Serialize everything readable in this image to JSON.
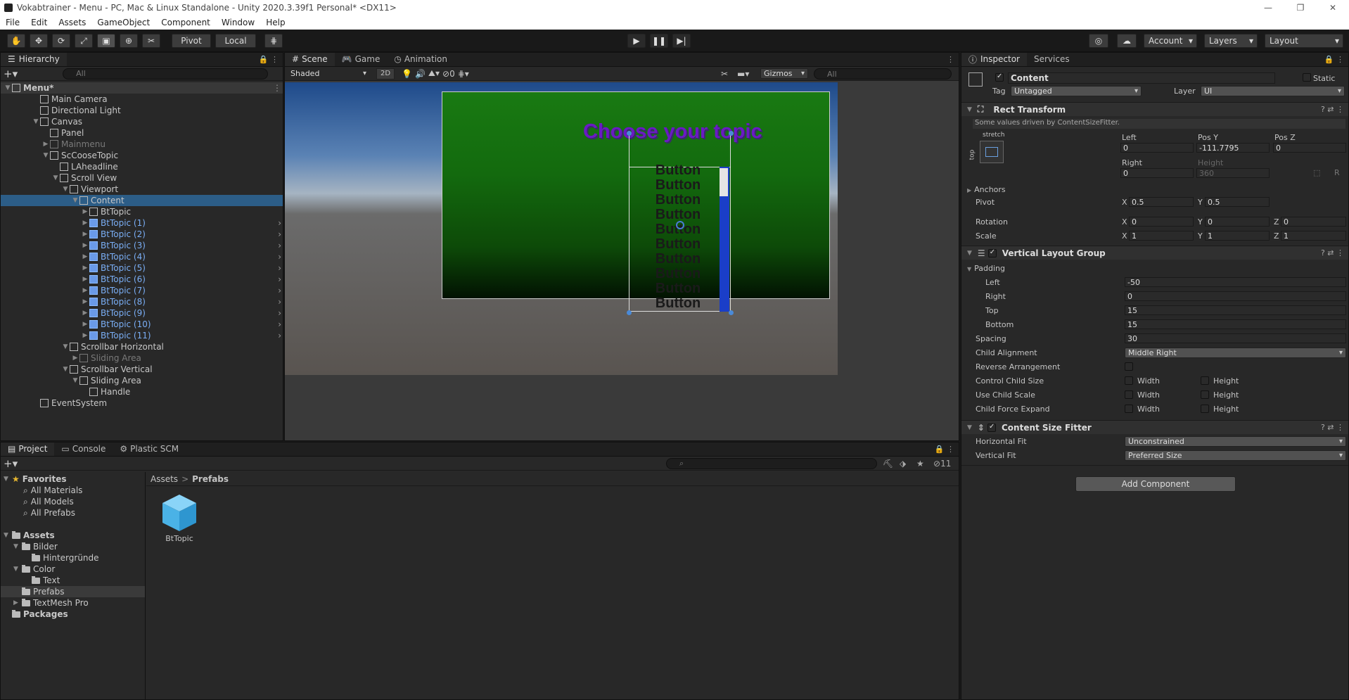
{
  "window": {
    "title": "Vokabtrainer - Menu - PC, Mac & Linux Standalone - Unity 2020.3.39f1 Personal* <DX11>",
    "controls": [
      "—",
      "❐",
      "✕"
    ]
  },
  "menu": [
    "File",
    "Edit",
    "Assets",
    "GameObject",
    "Component",
    "Window",
    "Help"
  ],
  "toolbar": {
    "pivot": "Pivot",
    "local": "Local",
    "account": "Account",
    "layers": "Layers",
    "layout": "Layout"
  },
  "hierarchy": {
    "tab": "Hierarchy",
    "search_placeholder": "All",
    "items": [
      {
        "label": "Menu*",
        "depth": 0,
        "kind": "scene",
        "arrow": "▼"
      },
      {
        "label": "Main Camera",
        "depth": 1,
        "kind": "go",
        "arrow": ""
      },
      {
        "label": "Directional Light",
        "depth": 1,
        "kind": "go",
        "arrow": ""
      },
      {
        "label": "Canvas",
        "depth": 1,
        "kind": "go",
        "arrow": "▼"
      },
      {
        "label": "Panel",
        "depth": 2,
        "kind": "go",
        "arrow": ""
      },
      {
        "label": "Mainmenu",
        "depth": 2,
        "kind": "dim",
        "arrow": "▶"
      },
      {
        "label": "ScCooseTopic",
        "depth": 2,
        "kind": "go",
        "arrow": "▼"
      },
      {
        "label": "LAheadline",
        "depth": 3,
        "kind": "go",
        "arrow": ""
      },
      {
        "label": "Scroll View",
        "depth": 3,
        "kind": "go",
        "arrow": "▼"
      },
      {
        "label": "Viewport",
        "depth": 4,
        "kind": "go",
        "arrow": "▼"
      },
      {
        "label": "Content",
        "depth": 5,
        "kind": "selected",
        "arrow": "▼"
      },
      {
        "label": "BtTopic",
        "depth": 6,
        "kind": "go",
        "arrow": "▶"
      },
      {
        "label": "BtTopic (1)",
        "depth": 6,
        "kind": "prefab",
        "arrow": "▶"
      },
      {
        "label": "BtTopic (2)",
        "depth": 6,
        "kind": "prefab",
        "arrow": "▶"
      },
      {
        "label": "BtTopic (3)",
        "depth": 6,
        "kind": "prefab",
        "arrow": "▶"
      },
      {
        "label": "BtTopic (4)",
        "depth": 6,
        "kind": "prefab",
        "arrow": "▶"
      },
      {
        "label": "BtTopic (5)",
        "depth": 6,
        "kind": "prefab",
        "arrow": "▶"
      },
      {
        "label": "BtTopic (6)",
        "depth": 6,
        "kind": "prefab",
        "arrow": "▶"
      },
      {
        "label": "BtTopic (7)",
        "depth": 6,
        "kind": "prefab",
        "arrow": "▶"
      },
      {
        "label": "BtTopic (8)",
        "depth": 6,
        "kind": "prefab",
        "arrow": "▶"
      },
      {
        "label": "BtTopic (9)",
        "depth": 6,
        "kind": "prefab",
        "arrow": "▶"
      },
      {
        "label": "BtTopic (10)",
        "depth": 6,
        "kind": "prefab",
        "arrow": "▶"
      },
      {
        "label": "BtTopic (11)",
        "depth": 6,
        "kind": "prefab",
        "arrow": "▶"
      },
      {
        "label": "Scrollbar Horizontal",
        "depth": 4,
        "kind": "go",
        "arrow": "▼"
      },
      {
        "label": "Sliding Area",
        "depth": 5,
        "kind": "dim",
        "arrow": "▶"
      },
      {
        "label": "Scrollbar Vertical",
        "depth": 4,
        "kind": "go",
        "arrow": "▼"
      },
      {
        "label": "Sliding Area",
        "depth": 5,
        "kind": "go",
        "arrow": "▼"
      },
      {
        "label": "Handle",
        "depth": 6,
        "kind": "go",
        "arrow": ""
      },
      {
        "label": "EventSystem",
        "depth": 1,
        "kind": "go",
        "arrow": ""
      }
    ]
  },
  "scene": {
    "tabs": [
      "Scene",
      "Game",
      "Animation"
    ],
    "shading": "Shaded",
    "mode_2d": "2D",
    "hidden_count": "0",
    "gizmos": "Gizmos",
    "search_placeholder": "All",
    "headline": "Choose your topic",
    "button_label": "Button",
    "button_count": 10
  },
  "inspector": {
    "tabs": [
      "Inspector",
      "Services"
    ],
    "object_name": "Content",
    "static_label": "Static",
    "tag_label": "Tag",
    "tag_value": "Untagged",
    "layer_label": "Layer",
    "layer_value": "UI",
    "rect_transform": {
      "title": "Rect Transform",
      "note": "Some values driven by ContentSizeFitter.",
      "anchor_h": "stretch",
      "anchor_v": "top",
      "left_label": "Left",
      "left": "0",
      "posy_label": "Pos Y",
      "posy": "-111.7795",
      "posz_label": "Pos Z",
      "posz": "0",
      "right_label": "Right",
      "right": "0",
      "height_label": "Height",
      "height": "360",
      "r_label": "R",
      "anchors": "Anchors",
      "pivot": "Pivot",
      "pivot_x": "0.5",
      "pivot_y": "0.5",
      "rotation": "Rotation",
      "rot_x": "0",
      "rot_y": "0",
      "rot_z": "0",
      "scale": "Scale",
      "scale_x": "1",
      "scale_y": "1",
      "scale_z": "1",
      "x": "X",
      "y": "Y",
      "z": "Z"
    },
    "vlg": {
      "title": "Vertical Layout Group",
      "padding": "Padding",
      "left_label": "Left",
      "left": "-50",
      "right_label": "Right",
      "right": "0",
      "top_label": "Top",
      "top": "15",
      "bottom_label": "Bottom",
      "bottom": "15",
      "spacing_label": "Spacing",
      "spacing": "30",
      "child_alignment_label": "Child Alignment",
      "child_alignment": "Middle Right",
      "reverse_label": "Reverse Arrangement",
      "control_label": "Control Child Size",
      "use_scale_label": "Use Child Scale",
      "force_expand_label": "Child Force Expand",
      "width": "Width",
      "height": "Height"
    },
    "csf": {
      "title": "Content Size Fitter",
      "hfit_label": "Horizontal Fit",
      "hfit": "Unconstrained",
      "vfit_label": "Vertical Fit",
      "vfit": "Preferred Size"
    },
    "add_component": "Add Component"
  },
  "project": {
    "tabs": [
      "Project",
      "Console",
      "Plastic SCM"
    ],
    "hidden_count": "11",
    "favorites": "Favorites",
    "fav_items": [
      "All Materials",
      "All Models",
      "All Prefabs"
    ],
    "assets": "Assets",
    "folders": [
      {
        "label": "Bilder",
        "depth": 1,
        "arrow": "▼"
      },
      {
        "label": "Hintergründe",
        "depth": 2,
        "arrow": ""
      },
      {
        "label": "Color",
        "depth": 1,
        "arrow": "▼"
      },
      {
        "label": "Text",
        "depth": 2,
        "arrow": ""
      },
      {
        "label": "Prefabs",
        "depth": 1,
        "arrow": ""
      },
      {
        "label": "TextMesh Pro",
        "depth": 1,
        "arrow": "▶"
      }
    ],
    "packages": "Packages",
    "breadcrumb": [
      "Assets",
      "Prefabs"
    ],
    "breadcrumb_sep": ">",
    "asset_name": "BtTopic"
  }
}
